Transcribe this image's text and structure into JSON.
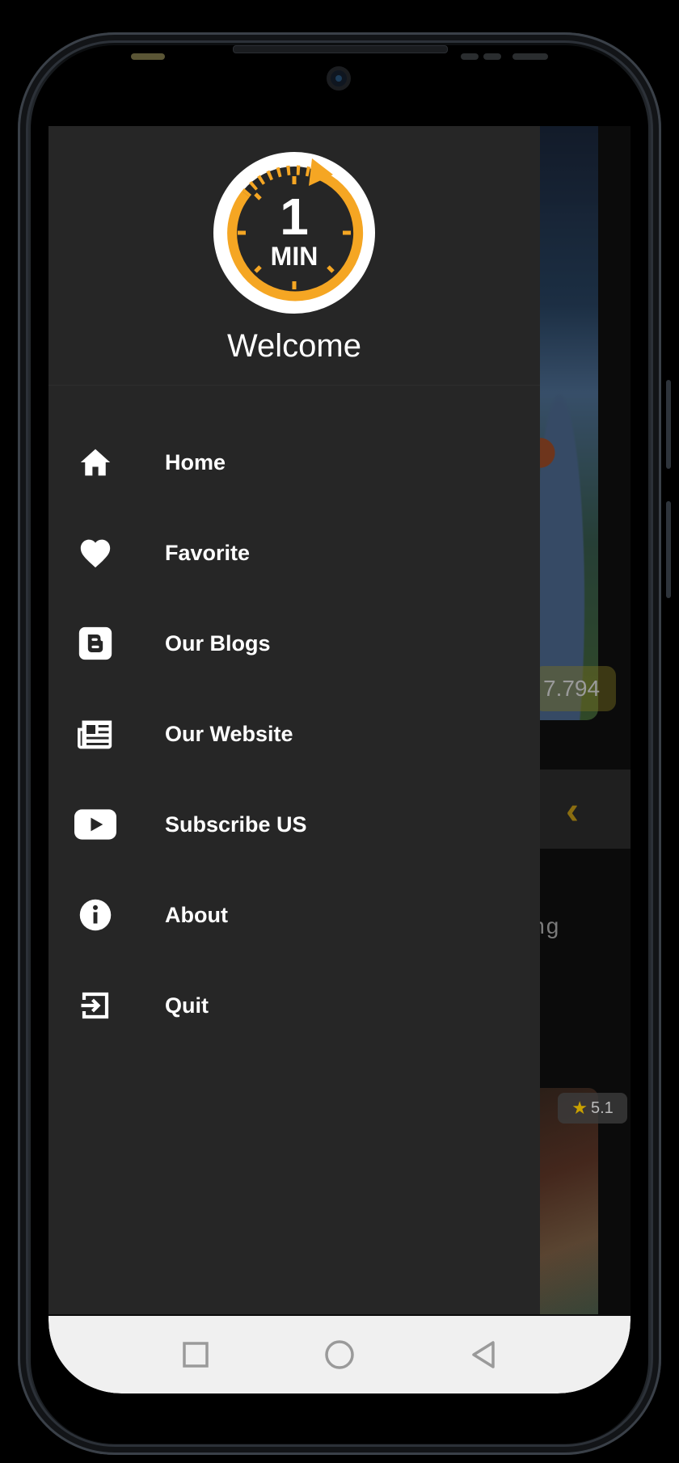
{
  "drawer": {
    "logo": {
      "number": "1",
      "unit": "MIN",
      "accent": "#F5A623"
    },
    "welcome": "Welcome",
    "items": [
      {
        "label": "Home",
        "icon": "home-icon"
      },
      {
        "label": "Favorite",
        "icon": "heart-icon"
      },
      {
        "label": "Our Blogs",
        "icon": "blogger-icon"
      },
      {
        "label": "Our Website",
        "icon": "newspaper-icon"
      },
      {
        "label": "Subscribe US",
        "icon": "youtube-icon"
      },
      {
        "label": "About",
        "icon": "info-icon"
      },
      {
        "label": "Quit",
        "icon": "exit-icon"
      }
    ]
  },
  "background": {
    "rating_top": "7.794",
    "partial_heading": "ing",
    "rating_bottom": "5.1"
  },
  "navbar": {
    "buttons": [
      "recents-button",
      "home-button",
      "back-button"
    ]
  },
  "colors": {
    "drawer_bg": "#262626",
    "accent": "#F5A623",
    "nav_bg": "#F0F0F0"
  }
}
